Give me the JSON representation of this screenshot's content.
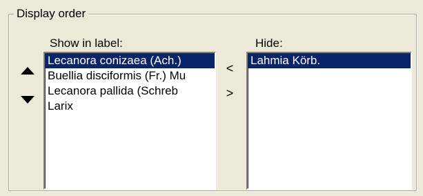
{
  "group": {
    "title": "Display order"
  },
  "show_list": {
    "label": "Show in label:",
    "items": [
      {
        "text": "Lecanora conizaea (Ach.)",
        "selected": true
      },
      {
        "text": "Buellia disciformis (Fr.) Mu",
        "selected": false
      },
      {
        "text": "Lecanora pallida (Schreb",
        "selected": false
      },
      {
        "text": "Larix",
        "selected": false
      }
    ]
  },
  "hide_list": {
    "label": "Hide:",
    "items": [
      {
        "text": "Lahmia Körb.",
        "selected": true
      }
    ]
  },
  "buttons": {
    "move_up": "arrow-up-icon",
    "move_down": "arrow-down-icon",
    "move_to_show": "<",
    "move_to_hide": ">"
  },
  "colors": {
    "selection": "#0a246a",
    "face": "#ece9d8"
  }
}
